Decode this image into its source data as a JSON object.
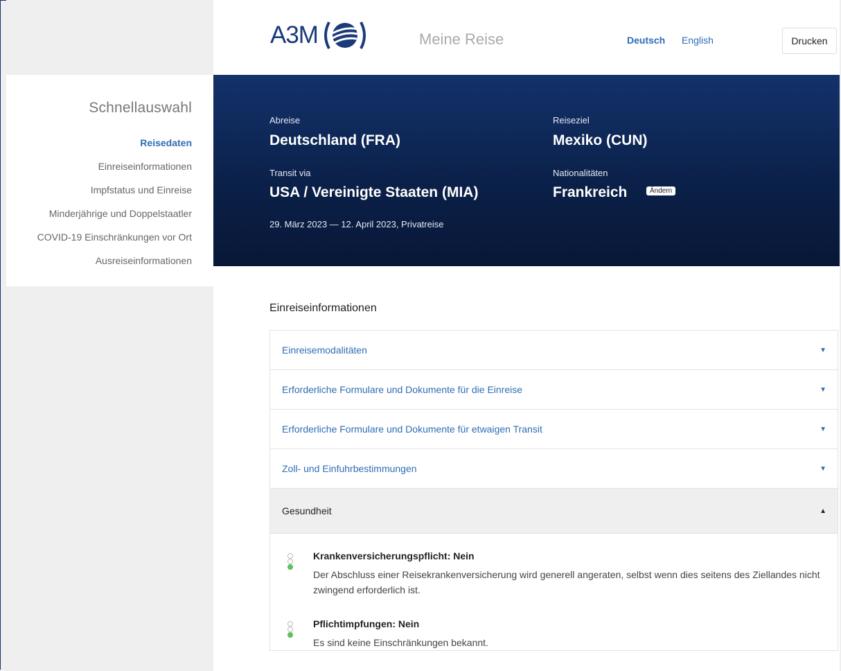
{
  "header": {
    "logo_text": "A3M",
    "logo_subtitle": "Meine Reise",
    "lang_de": "Deutsch",
    "lang_en": "English",
    "print_label": "Drucken"
  },
  "sidebar": {
    "title": "Schnellauswahl",
    "items": [
      {
        "label": "Reisedaten",
        "active": true
      },
      {
        "label": "Einreiseinformationen",
        "active": false
      },
      {
        "label": "Impfstatus und Einreise",
        "active": false
      },
      {
        "label": "Minderjährige und Doppelstaatler",
        "active": false
      },
      {
        "label": "COVID-19 Einschränkungen vor Ort",
        "active": false
      },
      {
        "label": "Ausreiseinformationen",
        "active": false
      }
    ]
  },
  "trip": {
    "departure_label": "Abreise",
    "departure_value": "Deutschland (FRA)",
    "destination_label": "Reiseziel",
    "destination_value": "Mexiko (CUN)",
    "transit_label": "Transit via",
    "transit_value": "USA / Vereinigte Staaten (MIA)",
    "nationality_label": "Nationalitäten",
    "nationality_value": "Frankreich",
    "change_label": "Ändern",
    "dates": "29. März 2023 — 12. April 2023, Privatreise"
  },
  "entry_info": {
    "title": "Einreiseinformationen",
    "accordion": [
      {
        "label": "Einreisemodalitäten",
        "arrow": "▼"
      },
      {
        "label": "Erforderliche Formulare und Dokumente für die Einreise",
        "arrow": "▼"
      },
      {
        "label": "Erforderliche Formulare und Dokumente für etwaigen Transit",
        "arrow": "▼"
      },
      {
        "label": "Zoll- und Einfuhrbestimmungen",
        "arrow": "▼"
      },
      {
        "label": "Gesundheit",
        "arrow": "▲"
      }
    ],
    "health": [
      {
        "title": "Krankenversicherungspflicht: Nein",
        "text": "Der Abschluss einer Reisekrankenversicherung wird generell angeraten, selbst wenn dies seitens des Ziellandes nicht zwingend erforderlich ist."
      },
      {
        "title": "Pflichtimpfungen: Nein",
        "text": "Es sind keine Einschränkungen bekannt."
      }
    ]
  },
  "colors": {
    "accent": "#2e6db4",
    "hero_dark": "#0b214a",
    "status_green": "#5cc25c"
  }
}
